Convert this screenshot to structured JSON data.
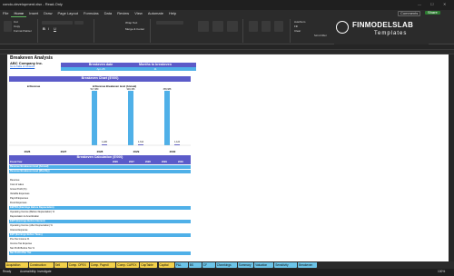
{
  "window": {
    "title": "condo-development.xlsx - Read-Only"
  },
  "menu": [
    "File",
    "Home",
    "Insert",
    "Draw",
    "Page Layout",
    "Formulas",
    "Data",
    "Review",
    "View",
    "Automate",
    "Help"
  ],
  "menu_active": "Home",
  "ribbon": {
    "buttons": [
      "Cut",
      "Copy",
      "Format Painter",
      "Wrap Text",
      "Merge & Center",
      "AutoSum",
      "Fill",
      "Clear",
      "Sort & Filter",
      "Find & Select",
      "Add-ins",
      "Analyze Data"
    ]
  },
  "topright": {
    "comments": "Comments",
    "share": "Share"
  },
  "brand": {
    "name": "FINMODELSLAB",
    "sub": "Templates"
  },
  "sheet": {
    "title": "Breakeven Analysis",
    "company": "ABC Company Inc.",
    "link": "Go to Table of Contents",
    "be_date_label": "Breakeven date",
    "be_date_value": "Apr-26",
    "months_label": "Months to breakeven",
    "months_value": "11",
    "chart_header": "Breakeven Chart ($'000)",
    "calc_header": "Breakeven Calculation ($'000)"
  },
  "chart_data": {
    "type": "bar",
    "categories": [
      "2026",
      "2027",
      "2028",
      "2029",
      "2030"
    ],
    "series": [
      {
        "name": "Revenue",
        "values": [
          null,
          null,
          517.38,
          946.156,
          365.988
        ]
      },
      {
        "name": "Revenue Breakeven level (Annual)",
        "values": [
          null,
          null,
          1.22,
          1.314,
          1.124
        ]
      }
    ],
    "data_labels": [
      "517,380",
      "946,156",
      "365,988",
      "1,220",
      "1,314",
      "1,124"
    ],
    "legend": [
      "Revenue",
      "Revenue Breakeven level (Annual)"
    ]
  },
  "calc_table": {
    "header": [
      "Fiscal Year",
      "2026",
      "2027",
      "2028",
      "2029",
      "2030"
    ],
    "rows": [
      "Revenue Breakeven level (Annual)",
      "Revenue Breakeven level (Monthly)",
      "",
      "Revenue",
      "Cost of sales",
      "Gross Profit (%)",
      "Variable Expenses",
      "Payroll Expenses",
      "Fixed Expenses",
      "EBITDA (Earnings Before Depreciation)",
      "Operating Income (Before Depreciation) %",
      "Depreciation & Amortization",
      "EBIT (Earnings Before Interest)",
      "Operating Income (After Depreciation) %",
      "Interest Expense",
      "EBT (Earnings Before Taxes)",
      "Pre-Tax Income %",
      "Income Tax Expense",
      "Net Profit Before Tax %",
      "Net Profit After Tax"
    ]
  },
  "tabs": [
    "Acquisition",
    "Construction",
    "Sell",
    "Comp. OPEX",
    "Comp. Payroll",
    "Comp. CAPEX",
    "CapTable",
    "Capital",
    "P&L",
    "BS",
    "CF",
    "Cfworkings",
    "Summary",
    "Valuation",
    "Sensitivity",
    "Breakeven"
  ],
  "tab_colors": [
    "#f2d04a",
    "#f2d04a",
    "#f2d04a",
    "#f2d04a",
    "#f2d04a",
    "#f2d04a",
    "#f2d04a",
    "#f2d04a",
    "#6cc4e8",
    "#6cc4e8",
    "#6cc4e8",
    "#6cc4e8",
    "#6cc4e8",
    "#6cc4e8",
    "#6cc4e8",
    "#6cc4e8"
  ],
  "status": {
    "ready": "Ready",
    "accessibility": "Accessibility: Investigate",
    "zoom": "100%"
  }
}
